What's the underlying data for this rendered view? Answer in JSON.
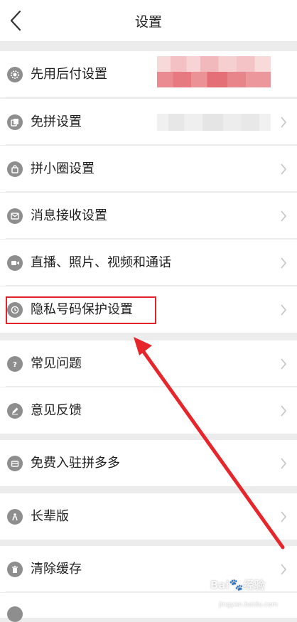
{
  "header": {
    "title": "设置"
  },
  "rows": [
    {
      "label": "先用后付设置",
      "icon": "gear-icon"
    },
    {
      "label": "免拼设置",
      "icon": "copy-icon"
    },
    {
      "label": "拼小圈设置",
      "icon": "bag-icon"
    },
    {
      "label": "消息接收设置",
      "icon": "mail-icon"
    },
    {
      "label": "直播、照片、视频和通话",
      "icon": "video-icon"
    },
    {
      "label": "隐私号码保护设置",
      "icon": "clock-icon"
    },
    {
      "label": "常见问题",
      "icon": "question-icon"
    },
    {
      "label": "意见反馈",
      "icon": "edit-icon"
    },
    {
      "label": "免费入驻拼多多",
      "icon": "store-icon"
    },
    {
      "label": "长辈版",
      "icon": "elder-icon"
    },
    {
      "label": "清除缓存",
      "icon": "trash-icon"
    }
  ],
  "watermark": {
    "brand": "Bai",
    "brand2": "经验",
    "sub": "jingyan.baidu.com"
  }
}
